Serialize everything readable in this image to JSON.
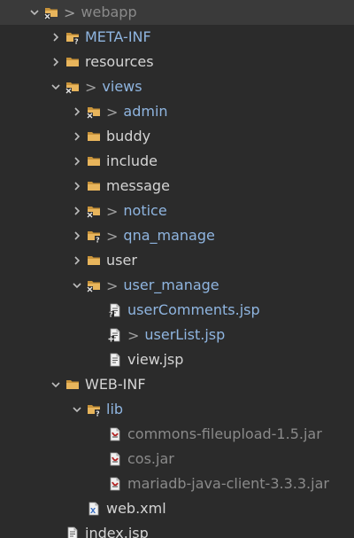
{
  "tree": [
    {
      "label": "webapp",
      "depth": 0,
      "expandable": true,
      "expanded": true,
      "icon": "folder-source-icon",
      "color": "gray",
      "changed": true,
      "selected": true,
      "name": "tree-item-webapp"
    },
    {
      "label": "META-INF",
      "depth": 1,
      "expandable": true,
      "expanded": false,
      "icon": "folder-question-icon",
      "color": "blue",
      "changed": false,
      "name": "tree-item-meta-inf"
    },
    {
      "label": "resources",
      "depth": 1,
      "expandable": true,
      "expanded": false,
      "icon": "folder-icon",
      "color": "default",
      "changed": false,
      "name": "tree-item-resources"
    },
    {
      "label": "views",
      "depth": 1,
      "expandable": true,
      "expanded": true,
      "icon": "folder-source-icon",
      "color": "blue",
      "changed": true,
      "name": "tree-item-views"
    },
    {
      "label": "admin",
      "depth": 2,
      "expandable": true,
      "expanded": false,
      "icon": "folder-source-icon",
      "color": "blue",
      "changed": true,
      "name": "tree-item-admin"
    },
    {
      "label": "buddy",
      "depth": 2,
      "expandable": true,
      "expanded": false,
      "icon": "folder-icon",
      "color": "default",
      "changed": false,
      "name": "tree-item-buddy"
    },
    {
      "label": "include",
      "depth": 2,
      "expandable": true,
      "expanded": false,
      "icon": "folder-icon",
      "color": "default",
      "changed": false,
      "name": "tree-item-include"
    },
    {
      "label": "message",
      "depth": 2,
      "expandable": true,
      "expanded": false,
      "icon": "folder-icon",
      "color": "default",
      "changed": false,
      "name": "tree-item-message"
    },
    {
      "label": "notice",
      "depth": 2,
      "expandable": true,
      "expanded": false,
      "icon": "folder-source-icon",
      "color": "blue",
      "changed": true,
      "name": "tree-item-notice"
    },
    {
      "label": "qna_manage",
      "depth": 2,
      "expandable": true,
      "expanded": false,
      "icon": "folder-question-icon",
      "color": "blue",
      "changed": true,
      "name": "tree-item-qna-manage"
    },
    {
      "label": "user",
      "depth": 2,
      "expandable": true,
      "expanded": false,
      "icon": "folder-icon",
      "color": "default",
      "changed": false,
      "name": "tree-item-user"
    },
    {
      "label": "user_manage",
      "depth": 2,
      "expandable": true,
      "expanded": true,
      "icon": "folder-source-icon",
      "color": "blue",
      "changed": true,
      "name": "tree-item-user-manage"
    },
    {
      "label": "userComments.jsp",
      "depth": 3,
      "expandable": false,
      "icon": "jsp-file-question-icon",
      "color": "blue",
      "changed": false,
      "name": "tree-item-usercomments-jsp"
    },
    {
      "label": "userList.jsp",
      "depth": 3,
      "expandable": false,
      "icon": "jsp-file-added-icon",
      "color": "blue",
      "changed": true,
      "name": "tree-item-userlist-jsp"
    },
    {
      "label": "view.jsp",
      "depth": 3,
      "expandable": false,
      "icon": "jsp-file-icon",
      "color": "default",
      "changed": false,
      "name": "tree-item-view-jsp"
    },
    {
      "label": "WEB-INF",
      "depth": 1,
      "expandable": true,
      "expanded": true,
      "icon": "folder-icon",
      "color": "default",
      "changed": false,
      "name": "tree-item-web-inf"
    },
    {
      "label": "lib",
      "depth": 2,
      "expandable": true,
      "expanded": true,
      "icon": "folder-question-icon",
      "color": "blue",
      "changed": false,
      "name": "tree-item-lib"
    },
    {
      "label": "commons-fileupload-1.5.jar",
      "depth": 3,
      "expandable": false,
      "icon": "jar-file-icon",
      "color": "gray",
      "changed": false,
      "name": "tree-item-commons-fileupload-jar"
    },
    {
      "label": "cos.jar",
      "depth": 3,
      "expandable": false,
      "icon": "jar-file-icon",
      "color": "gray",
      "changed": false,
      "name": "tree-item-cos-jar"
    },
    {
      "label": "mariadb-java-client-3.3.3.jar",
      "depth": 3,
      "expandable": false,
      "icon": "jar-file-icon",
      "color": "gray",
      "changed": false,
      "name": "tree-item-mariadb-jar"
    },
    {
      "label": "web.xml",
      "depth": 2,
      "expandable": false,
      "icon": "xml-file-icon",
      "color": "default",
      "changed": false,
      "name": "tree-item-web-xml"
    },
    {
      "label": "index.jsp",
      "depth": 1,
      "expandable": false,
      "icon": "jsp-file-icon",
      "color": "default",
      "changed": false,
      "name": "tree-item-index-jsp"
    }
  ],
  "change_marker": ">",
  "colors": {
    "background": "#2b2b2b",
    "selected_background": "#3a3a3a",
    "text_default": "#d4d4d4",
    "text_blue": "#8fb5e0",
    "text_gray": "#8a8a8a",
    "folder": "#e8b55c"
  }
}
